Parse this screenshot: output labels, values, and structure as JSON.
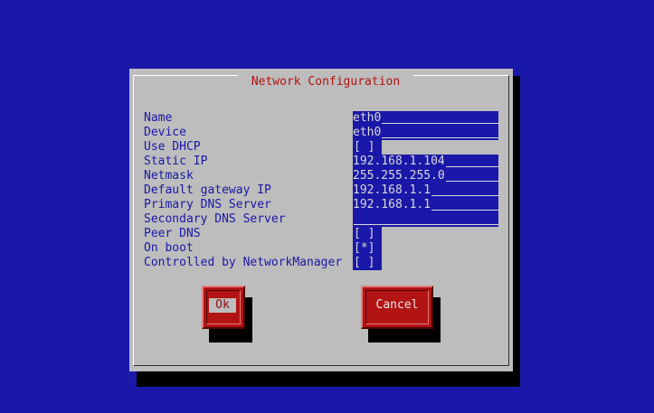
{
  "dialog": {
    "title": "Network Configuration",
    "fields": [
      {
        "label": "Name",
        "value": "eth0"
      },
      {
        "label": "Device",
        "value": "eth0"
      },
      {
        "label": "Use DHCP",
        "value": "[ ]"
      },
      {
        "label": "Static IP",
        "value": "192.168.1.104"
      },
      {
        "label": "Netmask",
        "value": "255.255.255.0"
      },
      {
        "label": "Default gateway IP",
        "value": "192.168.1.1"
      },
      {
        "label": "Primary DNS Server",
        "value": "192.168.1.1"
      },
      {
        "label": "Secondary DNS Server",
        "value": ""
      },
      {
        "label": "Peer DNS",
        "value": "[ ]"
      },
      {
        "label": "On boot",
        "value": "[*]"
      },
      {
        "label": "Controlled by NetworkManager",
        "value": "[ ]"
      }
    ]
  },
  "buttons": {
    "ok_label": "Ok",
    "cancel_label": "Cancel"
  },
  "colors": {
    "background": "#1a18a8",
    "dialog": "#bdbdbd",
    "title_text": "#b31111",
    "label_text": "#1818a6",
    "field_bg": "#1a18a8",
    "button": "#b21313"
  }
}
